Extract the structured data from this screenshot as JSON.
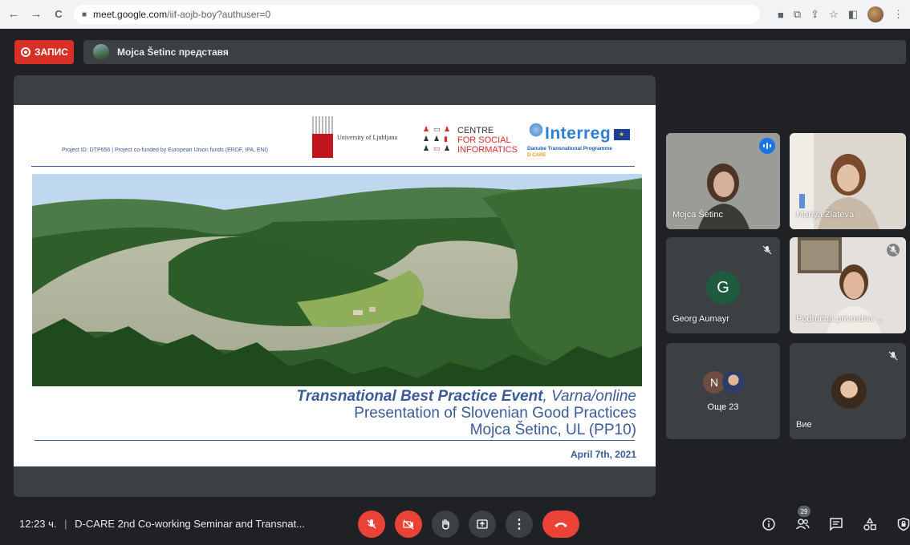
{
  "browser": {
    "url_host": "meet.google.com",
    "url_path": "/iif-aojb-boy?authuser=0"
  },
  "meeting": {
    "recording_label": "ЗАПИС",
    "presenter_label": "Mojca Šetinc представя",
    "time": "12:23 ч.",
    "separator": "|",
    "title": "D-CARE 2nd Co-working Seminar and Transnat...",
    "participant_count": "29"
  },
  "slide": {
    "project_id": "Project ID: DTP656 | Project co-funded by European Union funds (ERDF, IPA, ENI)",
    "university": "University of Ljubljana",
    "csi_line1": "CENTRE",
    "csi_line2": "FOR SOCIAL",
    "csi_line3": "INFORMATICS",
    "interreg": "Interreg",
    "interreg_sub": "Danube Transnational Programme",
    "interreg_project": "D-CARE",
    "title_bold": "Transnational Best Practice Event",
    "title_rest": ", Varna/online",
    "subtitle": "Presentation of Slovenian Good Practices",
    "author": "Mojca Šetinc, UL (PP10)",
    "date": "April 7th, 2021"
  },
  "participants": [
    {
      "name": "Mojca Šetinc",
      "status": "speaking"
    },
    {
      "name": "Mariya Zlateva",
      "status": "unmuted"
    },
    {
      "name": "Georg Aumayr",
      "initial": "G",
      "status": "muted",
      "avatar_color": "#1e5b3e"
    },
    {
      "name": "Područna privredna ...",
      "status": "muted"
    },
    {
      "name": "Още 23",
      "initial": "N",
      "avatar_color": "#6d4c41"
    },
    {
      "name": "Вие",
      "status": "muted"
    }
  ],
  "icons": {
    "back": "←",
    "forward": "→",
    "reload": "C",
    "lock": "🔒",
    "more": "⋮",
    "star": "☆",
    "share": "⇪"
  },
  "colors": {
    "end_call": "#ea4335",
    "recording": "#d93025",
    "speaking_accent": "#1a73e8",
    "slide_text": "#3a5a9a"
  }
}
